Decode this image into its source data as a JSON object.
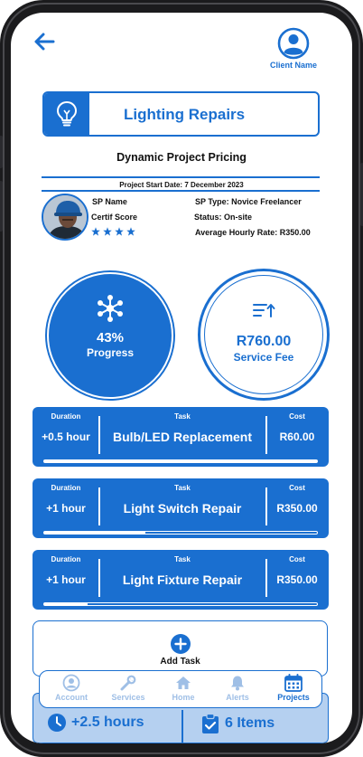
{
  "header": {
    "client_name": "Client Name"
  },
  "service": {
    "title": "Lighting Repairs",
    "icon": "lightbulb-icon"
  },
  "pricing_title": "Dynamic Project Pricing",
  "start_date": "Project Start Date: 7 December 2023",
  "sp": {
    "name": "SP Name",
    "certif": "Certif Score",
    "stars": 4,
    "type": "SP Type: Novice Freelancer",
    "status": "Status: On-site",
    "rate": "Average Hourly Rate: R350.00"
  },
  "progress": {
    "value": "43%",
    "label": "Progress",
    "fraction": 0.43
  },
  "service_fee": {
    "value": "R760.00",
    "label": "Service Fee"
  },
  "task_headers": {
    "duration": "Duration",
    "task": "Task",
    "cost": "Cost"
  },
  "tasks": [
    {
      "duration": "+0.5 hour",
      "name": "Bulb/LED Replacement",
      "cost": "R60.00",
      "progress": 1.0
    },
    {
      "duration": "+1 hour",
      "name": "Light Switch Repair",
      "cost": "R350.00",
      "progress": 0.37
    },
    {
      "duration": "+1 hour",
      "name": "Light Fixture Repair",
      "cost": "R350.00",
      "progress": 0.16
    }
  ],
  "add_task": {
    "label": "Add Task"
  },
  "nav": {
    "items": [
      {
        "label": "Account",
        "icon": "account-icon",
        "active": false
      },
      {
        "label": "Services",
        "icon": "wrench-icon",
        "active": false
      },
      {
        "label": "Home",
        "icon": "home-icon",
        "active": false
      },
      {
        "label": "Alerts",
        "icon": "bell-icon",
        "active": false
      },
      {
        "label": "Projects",
        "icon": "calendar-icon",
        "active": true
      }
    ]
  },
  "summary": {
    "hours": "+2.5 hours",
    "items": "6 Items"
  },
  "colors": {
    "accent": "#1a6fd0",
    "nav_inactive": "#9fbfe6",
    "summary_bg": "#b5d0f0"
  }
}
